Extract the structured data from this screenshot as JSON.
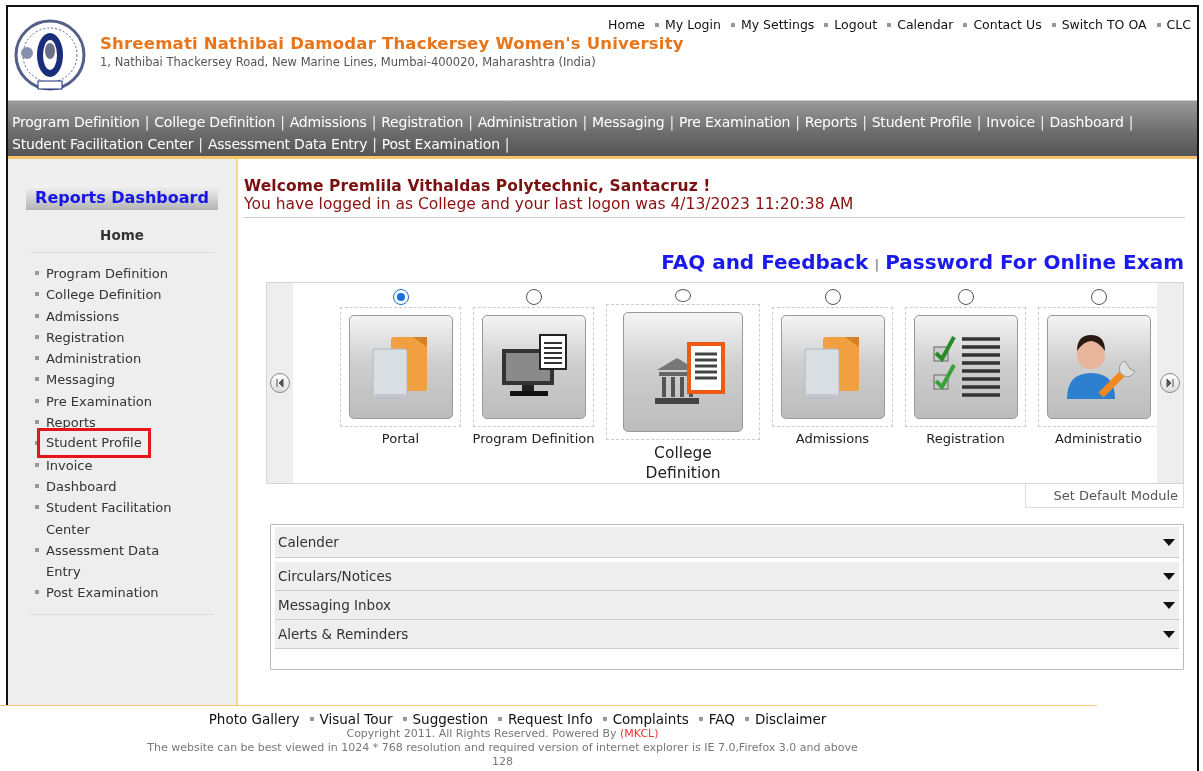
{
  "header": {
    "title": "Shreemati Nathibai Damodar Thackersey Women's University",
    "address": "1, Nathibai Thackersey Road, New Marine Lines, Mumbai-400020, Maharashtra (India)",
    "top_links": [
      "Home",
      "My Login",
      "My Settings",
      "Logout",
      "Calendar",
      "Contact Us",
      "Switch TO OA",
      "CLC"
    ]
  },
  "nav_separator": "|",
  "nav_menu": [
    "Program Definition",
    "College Definition",
    "Admissions",
    "Registration",
    "Administration",
    "Messaging",
    "Pre Examination",
    "Reports",
    "Student Profile",
    "Invoice",
    "Dashboard",
    "Student Facilitation Center",
    "Assessment Data Entry",
    "Post Examination"
  ],
  "sidebar": {
    "title": "Reports Dashboard",
    "home": "Home",
    "items": [
      {
        "label": "Program Definition",
        "highlighted": false
      },
      {
        "label": "College Definition",
        "highlighted": false
      },
      {
        "label": "Admissions",
        "highlighted": false
      },
      {
        "label": "Registration",
        "highlighted": false
      },
      {
        "label": "Administration",
        "highlighted": false
      },
      {
        "label": "Messaging",
        "highlighted": false
      },
      {
        "label": "Pre Examination",
        "highlighted": false
      },
      {
        "label": "Reports",
        "highlighted": false
      },
      {
        "label": "Student Profile",
        "highlighted": true
      },
      {
        "label": "Invoice",
        "highlighted": false
      },
      {
        "label": "Dashboard",
        "highlighted": false
      },
      {
        "label": "Student Facilitation Center",
        "highlighted": false
      },
      {
        "label": "Assessment Data Entry",
        "highlighted": false
      },
      {
        "label": "Post Examination",
        "highlighted": false
      }
    ]
  },
  "welcome": {
    "heading": "Welcome Premlila Vithaldas Polytechnic, Santacruz !",
    "message": "You have logged in as College and your last logon was 4/13/2023 11:20:38 AM"
  },
  "quick_links": [
    "FAQ and Feedback",
    "Password For Online Exam"
  ],
  "quick_separator": "|",
  "modules": [
    {
      "label": "Portal",
      "selected": true,
      "kind": "documents"
    },
    {
      "label": "Program Definition",
      "selected": false,
      "kind": "computer"
    },
    {
      "label": "College Definition",
      "selected": false,
      "kind": "building"
    },
    {
      "label": "Admissions",
      "selected": false,
      "kind": "documents"
    },
    {
      "label": "Registration",
      "selected": false,
      "kind": "checklist"
    },
    {
      "label": "Administratio",
      "selected": false,
      "kind": "person"
    }
  ],
  "set_default_button": "Set Default Module",
  "panels": [
    "Calender",
    "Circulars/Notices",
    "Messaging Inbox",
    "Alerts & Reminders"
  ],
  "footer": {
    "links": [
      "Photo Gallery",
      "Visual Tour",
      "Suggestion",
      "Request Info",
      "Complaints",
      "FAQ",
      "Disclaimer"
    ],
    "copyright": "Copyright 2011. All Rights Reserved. Powered By",
    "powered_by": "(MKCL)",
    "note": "The website can be best viewed in 1024 * 768 resolution and required version of internet explorer is IE 7.0,Firefox 3.0 and above",
    "counter": "128"
  }
}
